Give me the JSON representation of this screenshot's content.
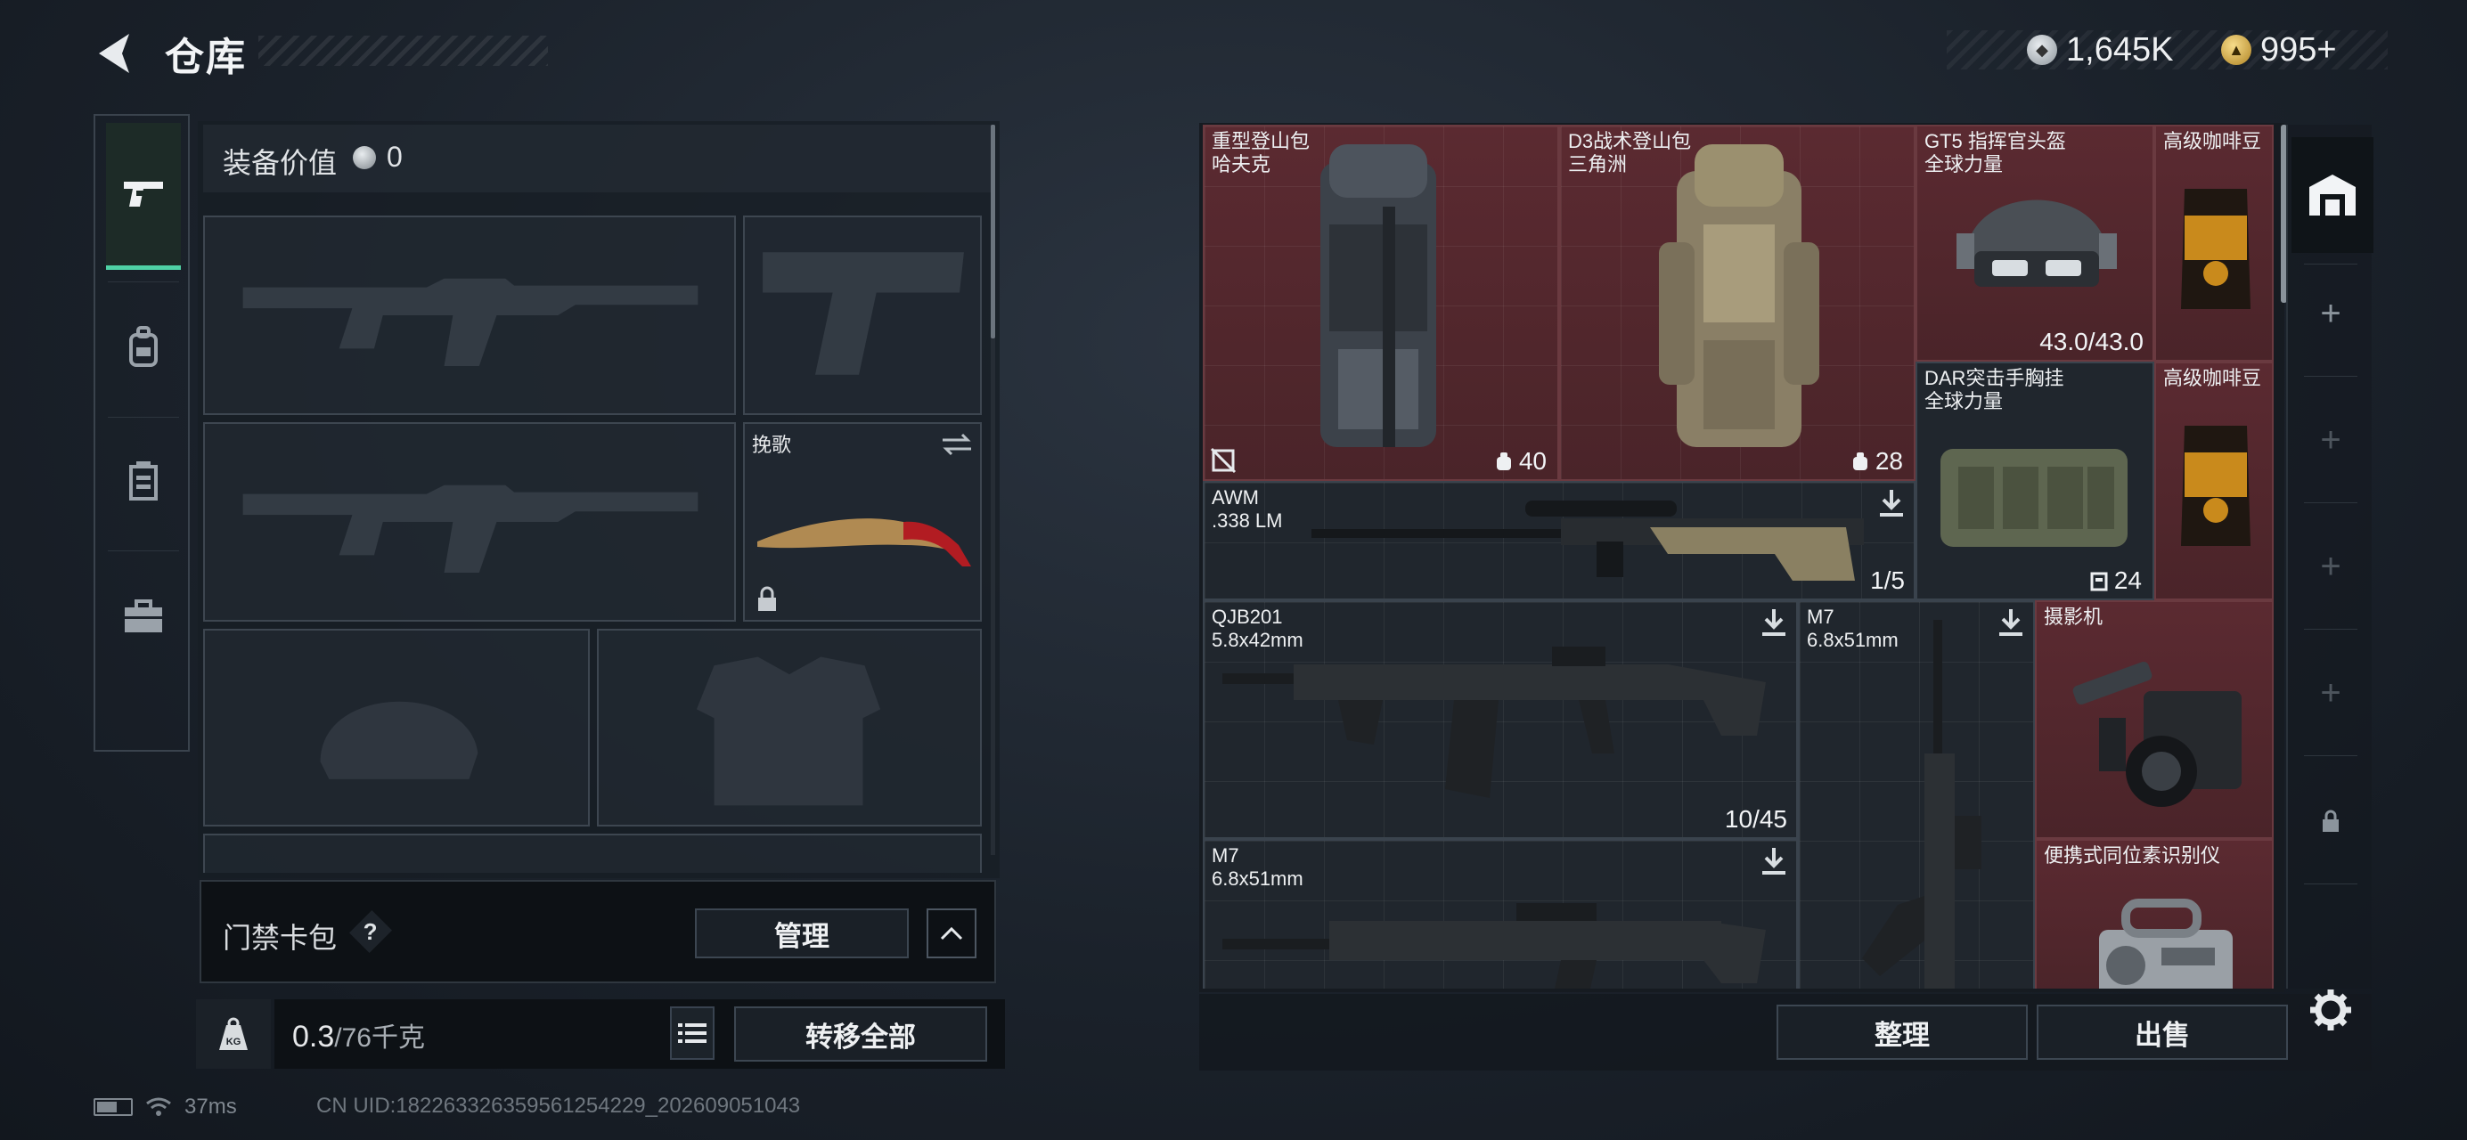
{
  "header": {
    "title": "仓库",
    "currencies": [
      {
        "icon": "silver-coin-icon",
        "value": "1,645K"
      },
      {
        "icon": "gold-coin-icon",
        "value": "995+"
      }
    ]
  },
  "categories": [
    {
      "name": "weapons",
      "icon": "pistol-icon",
      "active": true
    },
    {
      "name": "backpack",
      "icon": "backpack-icon",
      "active": false
    },
    {
      "name": "vest",
      "icon": "vest-icon",
      "active": false
    },
    {
      "name": "toolbox",
      "icon": "toolbox-icon",
      "active": false
    }
  ],
  "equipment": {
    "value_label": "装备价值",
    "value": "0",
    "melee_name": "挽歌",
    "access_card_label": "门禁卡包",
    "help": "?",
    "manage_label": "管理",
    "weight_current": "0.3",
    "weight_max": "/76千克",
    "transfer_label": "转移全部"
  },
  "storage": {
    "items": [
      {
        "id": "bag1",
        "name": "重型登山包\n哈夫克",
        "weight": "40",
        "color": "red"
      },
      {
        "id": "bag2",
        "name": "D3战术登山包\n三角洲",
        "weight": "28",
        "color": "red"
      },
      {
        "id": "helmet",
        "name": "GT5 指挥官头盔\n全球力量",
        "qty": "43.0/43.0",
        "color": "red"
      },
      {
        "id": "coffee1",
        "name": "高级咖啡豆",
        "color": "red"
      },
      {
        "id": "vest",
        "name": "DAR突击手胸挂\n全球力量",
        "weight": "24",
        "color": "dark"
      },
      {
        "id": "coffee2",
        "name": "高级咖啡豆",
        "color": "red"
      },
      {
        "id": "awm",
        "name": "AWM\n.338 LM",
        "qty": "1/5",
        "color": "dark"
      },
      {
        "id": "qjb",
        "name": "QJB201\n5.8x42mm",
        "qty": "10/45",
        "color": "dark"
      },
      {
        "id": "m7a",
        "name": "M7\n6.8x51mm",
        "color": "dark"
      },
      {
        "id": "camera",
        "name": "摄影机",
        "color": "red"
      },
      {
        "id": "m7b",
        "name": "M7\n6.8x51mm",
        "color": "dark"
      },
      {
        "id": "isotope",
        "name": "便携式同位素识别仪",
        "color": "red"
      }
    ],
    "sort_label": "整理",
    "sell_label": "出售"
  },
  "status": {
    "ping": "37ms",
    "uid": "CN UID:18226332635956125422​9_202609051043"
  },
  "colors": {
    "accent": "#4fd1a5",
    "item_red": "#5b2a31",
    "panel": "#1a2027"
  }
}
